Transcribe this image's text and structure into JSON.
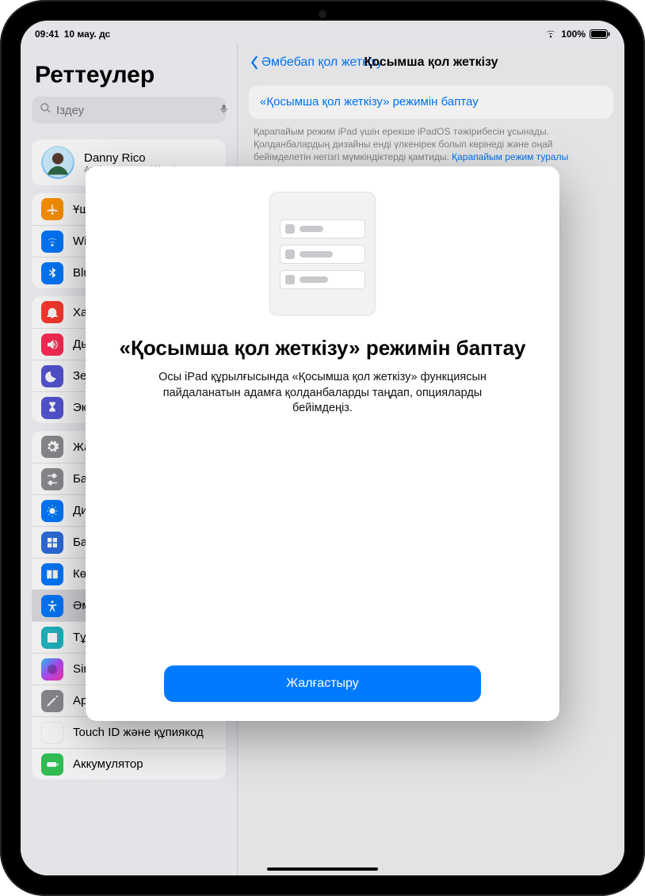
{
  "status": {
    "time": "09:41",
    "date": "10 мау. дс",
    "battery": "100%"
  },
  "sidebar": {
    "title": "Реттеулер",
    "search_placeholder": "Іздеу",
    "profile": {
      "name": "Danny Rico",
      "sub": "Apple аккаунты, iCloud+, медиа"
    },
    "g1": [
      "Ұшақ режимі",
      "Wi-Fi",
      "Bluetooth"
    ],
    "g2": [
      "Хабарландырулар",
      "Дыбыстар",
      "Зейін",
      "Экран уақыты"
    ],
    "g3": [
      "Жалпы",
      "Басқару орталығы",
      "Дисплей және жарықтық",
      "Басты экран және қолданба",
      "Көп тапсырма және пернелер",
      "Әмбебап қол жеткізу",
      "Тұсқағаз",
      "Siri және іздеу",
      "Apple Pencil",
      "Touch ID және құпиякод",
      "Аккумулятор"
    ]
  },
  "main": {
    "back": "Әмбебап қол жеткізу",
    "title": "Қосымша қол жеткізу",
    "card_link": "«Қосымша қол жеткізу» режимін баптау",
    "desc_a": "Қарапайым режим iPad үшін ерекше iPadOS тәжірибесін ұсынады. Қолданбалардың дизайны енді үлкенірек болып көрінеді және оңай бейімделетін негізгі мүмкіндіктерді қамтиды. ",
    "desc_link": "Қарапайым режим туралы толығырақ…"
  },
  "modal": {
    "title": "«Қосымша қол жеткізу» режимін баптау",
    "body": "Осы iPad құрылғысында «Қосымша қол жеткізу» функциясын пайдаланатын адамға қолданбаларды таңдап, опцияларды бейімдеңіз.",
    "cta": "Жалғастыру"
  },
  "colors": {
    "airplane": "#ff9500",
    "wifi": "#007aff",
    "bt": "#007aff",
    "notif": "#ff3b30",
    "sound": "#ff2d55",
    "focus": "#5856d6",
    "screentime": "#5856d6",
    "general": "#8e8e93",
    "control": "#8e8e93",
    "display": "#007aff",
    "home": "#2f6fe0",
    "multitask": "#007aff",
    "access": "#007aff",
    "wallpaper": "#22b8c4",
    "siri": "#1b1b1d",
    "pencil": "#8e8e93",
    "touchid": "#ff3b30",
    "battery": "#34c759"
  }
}
